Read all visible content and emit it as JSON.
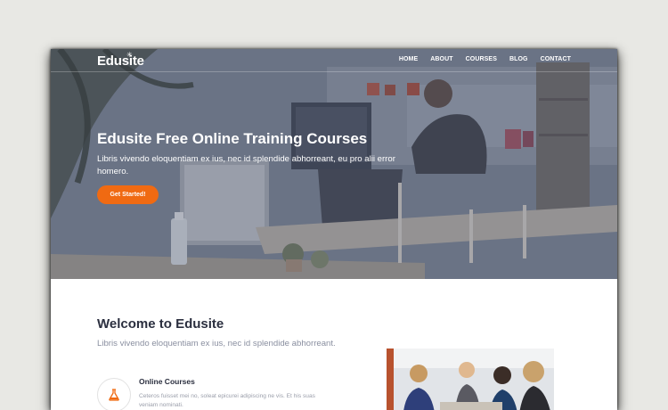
{
  "brand": {
    "name": "Edusite"
  },
  "nav": {
    "items": [
      "HOME",
      "ABOUT",
      "COURSES",
      "BLOG",
      "CONTACT"
    ]
  },
  "hero": {
    "title": "Edusite Free Online Training Courses",
    "subtitle": "Libris vivendo eloquentiam ex ius, nec id splendide abhorreant, eu pro alii error homero.",
    "cta_label": "Get Started!"
  },
  "welcome": {
    "title": "Welcome to Edusite",
    "subtitle": "Libris vivendo eloquentiam ex ius, nec id splendide abhorreant."
  },
  "course": {
    "title": "Online Courses",
    "description": "Ceteros fuisset mei no, soleat epicurei adipiscing ne vis. Et his suas veniam nominati.",
    "icon": "flask-icon"
  },
  "colors": {
    "accent": "#f06a12",
    "heading": "#2b2f3f",
    "muted": "#8a8fa0"
  }
}
